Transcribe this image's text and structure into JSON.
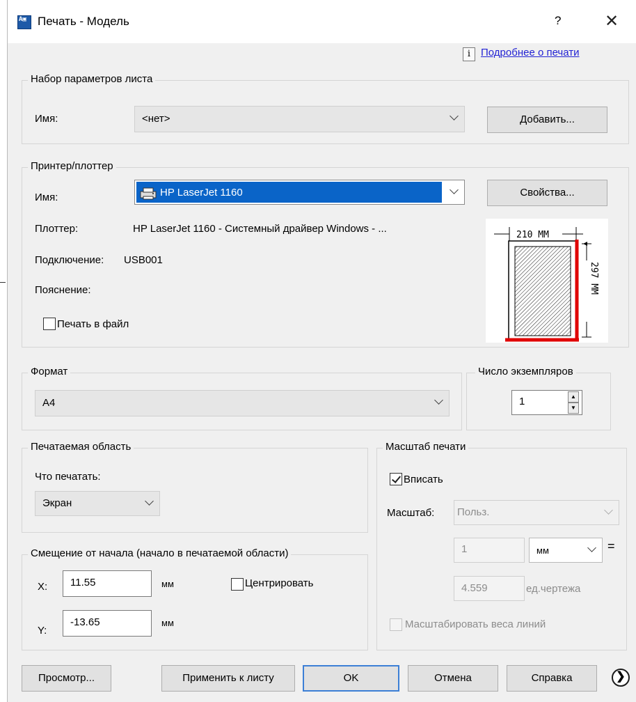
{
  "window": {
    "title": "Печать - Модель",
    "help_label": "?",
    "close_label": "✕",
    "more_link": "Подробнее о печати",
    "info_icon": "i"
  },
  "page_setup": {
    "legend": "Набор параметров листа",
    "name_label": "Имя:",
    "name_value": "<нет>",
    "add_button": "Добавить..."
  },
  "printer": {
    "legend": "Принтер/плоттер",
    "name_label": "Имя:",
    "name_value": "HP LaserJet 1160",
    "properties_button": "Свойства...",
    "plotter_label": "Плоттер:",
    "plotter_value": "HP LaserJet 1160 - Системный драйвер Windows - ...",
    "connection_label": "Подключение:",
    "connection_value": "USB001",
    "description_label": "Пояснение:",
    "print_to_file_label": "Печать в файл",
    "print_to_file_checked": false,
    "preview_width_label": "210 MM",
    "preview_height_label": "297 MM"
  },
  "format": {
    "legend": "Формат",
    "value": "A4"
  },
  "copies": {
    "legend": "Число экземпляров",
    "value": "1"
  },
  "plot_area": {
    "legend": "Печатаемая область",
    "what_label": "Что печатать:",
    "what_value": "Экран"
  },
  "plot_offset": {
    "legend": "Смещение от начала (начало в печатаемой области)",
    "x_label": "X:",
    "x_value": "11.55",
    "x_unit": "мм",
    "y_label": "Y:",
    "y_value": "-13.65",
    "y_unit": "мм",
    "center_label": "Центрировать",
    "center_checked": false
  },
  "plot_scale": {
    "legend": "Масштаб печати",
    "fit_label": "Вписать",
    "fit_checked": true,
    "scale_label": "Масштаб:",
    "scale_value": "Польз.",
    "value1": "1",
    "unit1": "мм",
    "equals": "=",
    "value2": "4.559",
    "unit2": "ед.чертежа",
    "lineweights_label": "Масштабировать веса линий",
    "lineweights_checked": false
  },
  "footer": {
    "preview_button": "Просмотр...",
    "apply_button": "Применить к листу",
    "ok_button": "OK",
    "cancel_button": "Отмена",
    "help_button": "Справка",
    "more_icon": "❯"
  }
}
